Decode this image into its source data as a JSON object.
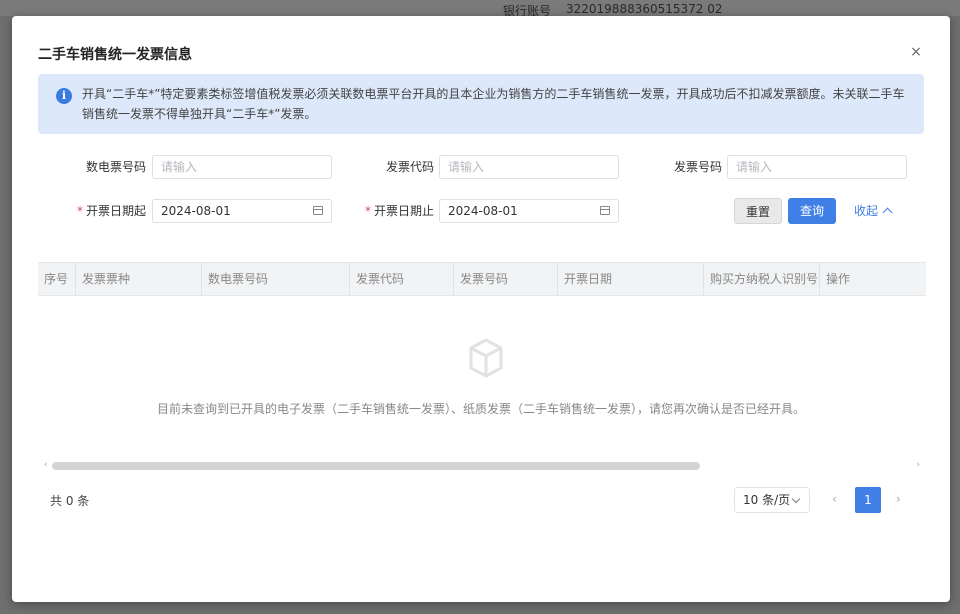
{
  "background": {
    "label_partial": "银行账号",
    "account": "322019888360515372 02"
  },
  "modal": {
    "title": "二手车销售统一发票信息",
    "close": "×"
  },
  "alert": {
    "icon": "i",
    "text": "开具“二手车*”特定要素类标签增值税发票必须关联数电票平台开具的且本企业为销售方的二手车销售统一发票，开具成功后不扣减发票额度。未关联二手车销售统一发票不得单独开具“二手车*”发票。"
  },
  "form": {
    "digital_invoice_no": {
      "label": "数电票号码",
      "placeholder": "请输入"
    },
    "invoice_code": {
      "label": "发票代码",
      "placeholder": "请输入"
    },
    "invoice_no": {
      "label": "发票号码",
      "placeholder": "请输入"
    },
    "date_start": {
      "label": "开票日期起",
      "value": "2024-08-01",
      "required": "*"
    },
    "date_end": {
      "label": "开票日期止",
      "value": "2024-08-01",
      "required": "*"
    },
    "reset_label": "重置",
    "query_label": "查询",
    "collapse_label": "收起"
  },
  "table": {
    "columns": [
      "序号",
      "发票票种",
      "数电票号码",
      "发票代码",
      "发票号码",
      "开票日期",
      "购买方纳税人识别号",
      "操作"
    ],
    "empty_text": "目前未查询到已开具的电子发票（二手车销售统一发票）、纸质发票（二手车销售统一发票），请您再次确认是否已经开具。"
  },
  "pagination": {
    "total": "共 0 条",
    "page_size": "10 条/页",
    "prev": "‹",
    "current": "1",
    "next": "›"
  },
  "colors": {
    "primary": "#3f7fe6",
    "alert_bg": "#dde9fb",
    "required": "#e5484d"
  }
}
